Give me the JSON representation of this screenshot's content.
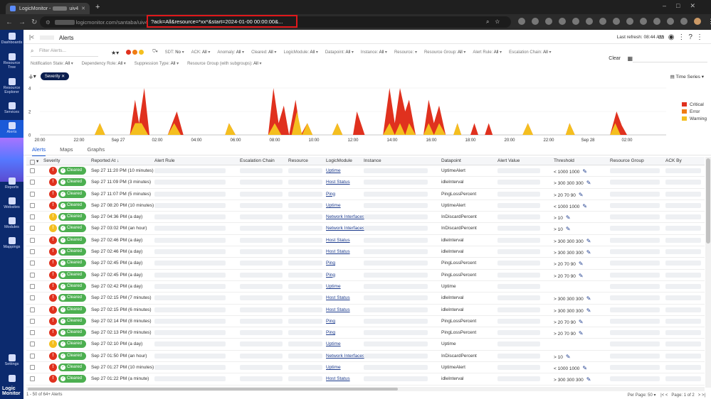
{
  "browser": {
    "tab_title": "LogicMonitor -",
    "tab_suffix": "uiv4",
    "url_host": "logicmonitor.com/santaba/uiv4/alerts",
    "url_query": "?ack=All&resource=*xx*&start=2024-01-00 00:00:00&..."
  },
  "nav": {
    "items": [
      {
        "label": "Dashboards"
      },
      {
        "label": "Resource Tree"
      },
      {
        "label": "Resource Explorer"
      },
      {
        "label": "Services"
      },
      {
        "label": "Alerts"
      },
      {
        "label": "Reports"
      },
      {
        "label": "Websites"
      },
      {
        "label": "Modules"
      },
      {
        "label": "Mappings"
      },
      {
        "label": "Settings"
      }
    ],
    "brand": "Logic Monitor"
  },
  "header": {
    "title": "Alerts",
    "last_refresh": "Last refresh: 08:44 AM"
  },
  "filters": {
    "search_placeholder": "Filter Alerts...",
    "row1": [
      {
        "label": "SDT:",
        "value": "No"
      },
      {
        "label": "ACK:",
        "value": "All"
      },
      {
        "label": "Anomaly:",
        "value": "All"
      },
      {
        "label": "Cleared:",
        "value": "All"
      },
      {
        "label": "LogicModule:",
        "value": "All"
      },
      {
        "label": "Datapoint:",
        "value": "All"
      },
      {
        "label": "Instance:",
        "value": "All"
      },
      {
        "label": "Resource:",
        "value": ""
      },
      {
        "label": "Resource Group:",
        "value": "All"
      },
      {
        "label": "Alert Rule:",
        "value": "All"
      },
      {
        "label": "Escalation Chain:",
        "value": "All"
      }
    ],
    "row2": [
      {
        "label": "Notification State:",
        "value": "All"
      },
      {
        "label": "Dependency Role:",
        "value": "All"
      },
      {
        "label": "Suppression Type:",
        "value": "All"
      },
      {
        "label": "Resource Group (with subgroups):",
        "value": "All"
      }
    ],
    "clear_label": "Clear",
    "chip": "Severity",
    "view_mode": "Time Series"
  },
  "chart_data": {
    "type": "area",
    "x_ticks": [
      "20:00",
      "22:00",
      "Sep 27",
      "02:00",
      "04:00",
      "06:00",
      "08:00",
      "10:00",
      "12:00",
      "14:00",
      "16:00",
      "18:00",
      "20:00",
      "22:00",
      "Sep 28",
      "02:00"
    ],
    "ylim": [
      0,
      4
    ],
    "y_ticks": [
      "0",
      "2",
      "4"
    ],
    "series": [
      {
        "name": "Critical",
        "color": "#e0311e",
        "points": [
          [
            0,
            0
          ],
          [
            4.2,
            0
          ],
          [
            4.6,
            1
          ],
          [
            5,
            0
          ],
          [
            6.9,
            0
          ],
          [
            7.3,
            3
          ],
          [
            7.6,
            1
          ],
          [
            8,
            4
          ],
          [
            8.4,
            0
          ],
          [
            9.8,
            0
          ],
          [
            10.5,
            2
          ],
          [
            11,
            0
          ],
          [
            14.2,
            0
          ],
          [
            14.5,
            1
          ],
          [
            15,
            0
          ],
          [
            17.5,
            0
          ],
          [
            17.9,
            4
          ],
          [
            18.3,
            1
          ],
          [
            18.7,
            2.5
          ],
          [
            19.1,
            0
          ],
          [
            19.6,
            3
          ],
          [
            20,
            0
          ],
          [
            20.5,
            1
          ],
          [
            20.9,
            0
          ],
          [
            22.4,
            0
          ],
          [
            22.8,
            1
          ],
          [
            23.2,
            0
          ],
          [
            24,
            0
          ],
          [
            24.3,
            2
          ],
          [
            24.6,
            1
          ],
          [
            24.9,
            0
          ],
          [
            26.3,
            0
          ],
          [
            26.8,
            4
          ],
          [
            27.2,
            1
          ],
          [
            27.6,
            4
          ],
          [
            28,
            2
          ],
          [
            28.3,
            3
          ],
          [
            28.8,
            0
          ],
          [
            29.4,
            0
          ],
          [
            29.8,
            3
          ],
          [
            30.2,
            1
          ],
          [
            30.6,
            2.5
          ],
          [
            31.1,
            0
          ],
          [
            31.7,
            0
          ],
          [
            32,
            1
          ],
          [
            32.3,
            0
          ],
          [
            33,
            0
          ],
          [
            33.3,
            1
          ],
          [
            33.6,
            0
          ],
          [
            34.1,
            0
          ],
          [
            34.4,
            1
          ],
          [
            34.7,
            0
          ],
          [
            37,
            0
          ],
          [
            37.4,
            1
          ],
          [
            37.8,
            0
          ],
          [
            40.3,
            0
          ],
          [
            40.6,
            1
          ],
          [
            41,
            0
          ],
          [
            43.7,
            0
          ],
          [
            44.2,
            2
          ],
          [
            44.6,
            0.8
          ],
          [
            45,
            0
          ],
          [
            48,
            0
          ]
        ]
      },
      {
        "name": "Error",
        "color": "#f07c14",
        "points": []
      },
      {
        "name": "Warning",
        "color": "#f4bf1f",
        "points": [
          [
            0,
            0
          ],
          [
            4.2,
            0
          ],
          [
            4.6,
            1
          ],
          [
            5,
            0
          ],
          [
            6.9,
            0
          ],
          [
            7.3,
            1
          ],
          [
            7.8,
            1
          ],
          [
            8.3,
            0
          ],
          [
            9.8,
            0
          ],
          [
            10.3,
            1
          ],
          [
            10.8,
            0
          ],
          [
            14.2,
            0
          ],
          [
            14.5,
            1
          ],
          [
            15,
            0
          ],
          [
            17.5,
            0
          ],
          [
            18,
            1
          ],
          [
            18.5,
            0
          ],
          [
            19.3,
            0
          ],
          [
            19.7,
            2
          ],
          [
            20.1,
            0
          ],
          [
            20.5,
            1
          ],
          [
            20.9,
            0
          ],
          [
            22.4,
            0
          ],
          [
            22.8,
            1
          ],
          [
            23.2,
            0
          ],
          [
            26.3,
            0
          ],
          [
            26.8,
            1
          ],
          [
            27.2,
            0
          ],
          [
            27.6,
            1
          ],
          [
            28,
            0
          ],
          [
            28.3,
            1
          ],
          [
            28.8,
            0
          ],
          [
            29.4,
            0
          ],
          [
            29.8,
            1
          ],
          [
            30.2,
            0
          ],
          [
            30.6,
            1
          ],
          [
            31.1,
            0
          ],
          [
            31.7,
            0
          ],
          [
            32,
            1
          ],
          [
            32.3,
            0
          ],
          [
            37,
            0
          ],
          [
            37.4,
            1
          ],
          [
            37.8,
            0
          ],
          [
            40.3,
            0
          ],
          [
            40.6,
            1
          ],
          [
            41,
            0
          ],
          [
            43.7,
            0
          ],
          [
            44.1,
            1
          ],
          [
            44.5,
            0
          ],
          [
            48,
            0
          ]
        ]
      }
    ]
  },
  "tabs": [
    "Alerts",
    "Maps",
    "Graphs"
  ],
  "table": {
    "columns": [
      "Severity",
      "Reported At",
      "Alert Rule",
      "Escalation Chain",
      "Resource",
      "LogicModule",
      "Instance",
      "Datapoint",
      "Alert Value",
      "Threshold",
      "Resource Group",
      "ACK By"
    ],
    "status_label": "Cleared",
    "rows": [
      {
        "sev": "critical",
        "at": "Sep 27 11:20 PM  (10 minutes)",
        "module": "Uptime",
        "dp": "UptimeAlert",
        "th": "< 1000 1000"
      },
      {
        "sev": "critical",
        "at": "Sep 27 11:09 PM  (3 minutes)",
        "module": "Host Status",
        "dp": "idleInterval",
        "th": "> 300 300 300"
      },
      {
        "sev": "critical",
        "at": "Sep 27 11:07 PM  (5 minutes)",
        "module": "Ping",
        "dp": "PingLossPercent",
        "th": "> 20 70 90"
      },
      {
        "sev": "critical",
        "at": "Sep 27 08:20 PM  (10 minutes)",
        "module": "Uptime",
        "dp": "UptimeAlert",
        "th": "< 1000 1000"
      },
      {
        "sev": "warning",
        "at": "Sep 27 04:36 PM  (a day)",
        "module": "Network Interfaces",
        "dp": "InDiscardPercent",
        "th": "> 10"
      },
      {
        "sev": "warning",
        "at": "Sep 27 03:02 PM  (an hour)",
        "module": "Network Interfaces",
        "dp": "InDiscardPercent",
        "th": "> 10"
      },
      {
        "sev": "critical",
        "at": "Sep 27 02:46 PM  (a day)",
        "module": "Host Status",
        "dp": "idleInterval",
        "th": "> 300 300 300"
      },
      {
        "sev": "critical",
        "at": "Sep 27 02:46 PM  (a day)",
        "module": "Host Status",
        "dp": "idleInterval",
        "th": "> 300 300 300"
      },
      {
        "sev": "critical",
        "at": "Sep 27 02:45 PM  (a day)",
        "module": "Ping",
        "dp": "PingLossPercent",
        "th": "> 20 70 90"
      },
      {
        "sev": "critical",
        "at": "Sep 27 02:45 PM  (a day)",
        "module": "Ping",
        "dp": "PingLossPercent",
        "th": "> 20 70 90"
      },
      {
        "sev": "critical",
        "at": "Sep 27 02:42 PM  (a day)",
        "module": "Uptime",
        "dp": "Uptime",
        "th": ""
      },
      {
        "sev": "critical",
        "at": "Sep 27 02:15 PM  (7 minutes)",
        "module": "Host Status",
        "dp": "idleInterval",
        "th": "> 300 300 300"
      },
      {
        "sev": "critical",
        "at": "Sep 27 02:15 PM  (6 minutes)",
        "module": "Host Status",
        "dp": "idleInterval",
        "th": "> 300 300 300"
      },
      {
        "sev": "critical",
        "at": "Sep 27 02:14 PM  (8 minutes)",
        "module": "Ping",
        "dp": "PingLossPercent",
        "th": "> 20 70 90"
      },
      {
        "sev": "critical",
        "at": "Sep 27 02:13 PM  (9 minutes)",
        "module": "Ping",
        "dp": "PingLossPercent",
        "th": "> 20 70 90"
      },
      {
        "sev": "warning",
        "at": "Sep 27 02:10 PM  (a day)",
        "module": "Uptime",
        "dp": "Uptime",
        "th": ""
      },
      {
        "sev": "critical",
        "at": "Sep 27 01:50 PM  (an hour)",
        "module": "Network Interfaces",
        "dp": "InDiscardPercent",
        "th": "> 10"
      },
      {
        "sev": "critical",
        "at": "Sep 27 01:27 PM  (10 minutes)",
        "module": "Uptime",
        "dp": "UptimeAlert",
        "th": "< 1000 1000"
      },
      {
        "sev": "critical",
        "at": "Sep 27 01:22 PM  (a minute)",
        "module": "Host Status",
        "dp": "idleInterval",
        "th": "> 300 300 300"
      }
    ]
  },
  "footer": {
    "count": "1 - 50 of 64+ Alerts",
    "per_page": "Per Page: 50",
    "page": "Page: 1 of 2"
  }
}
